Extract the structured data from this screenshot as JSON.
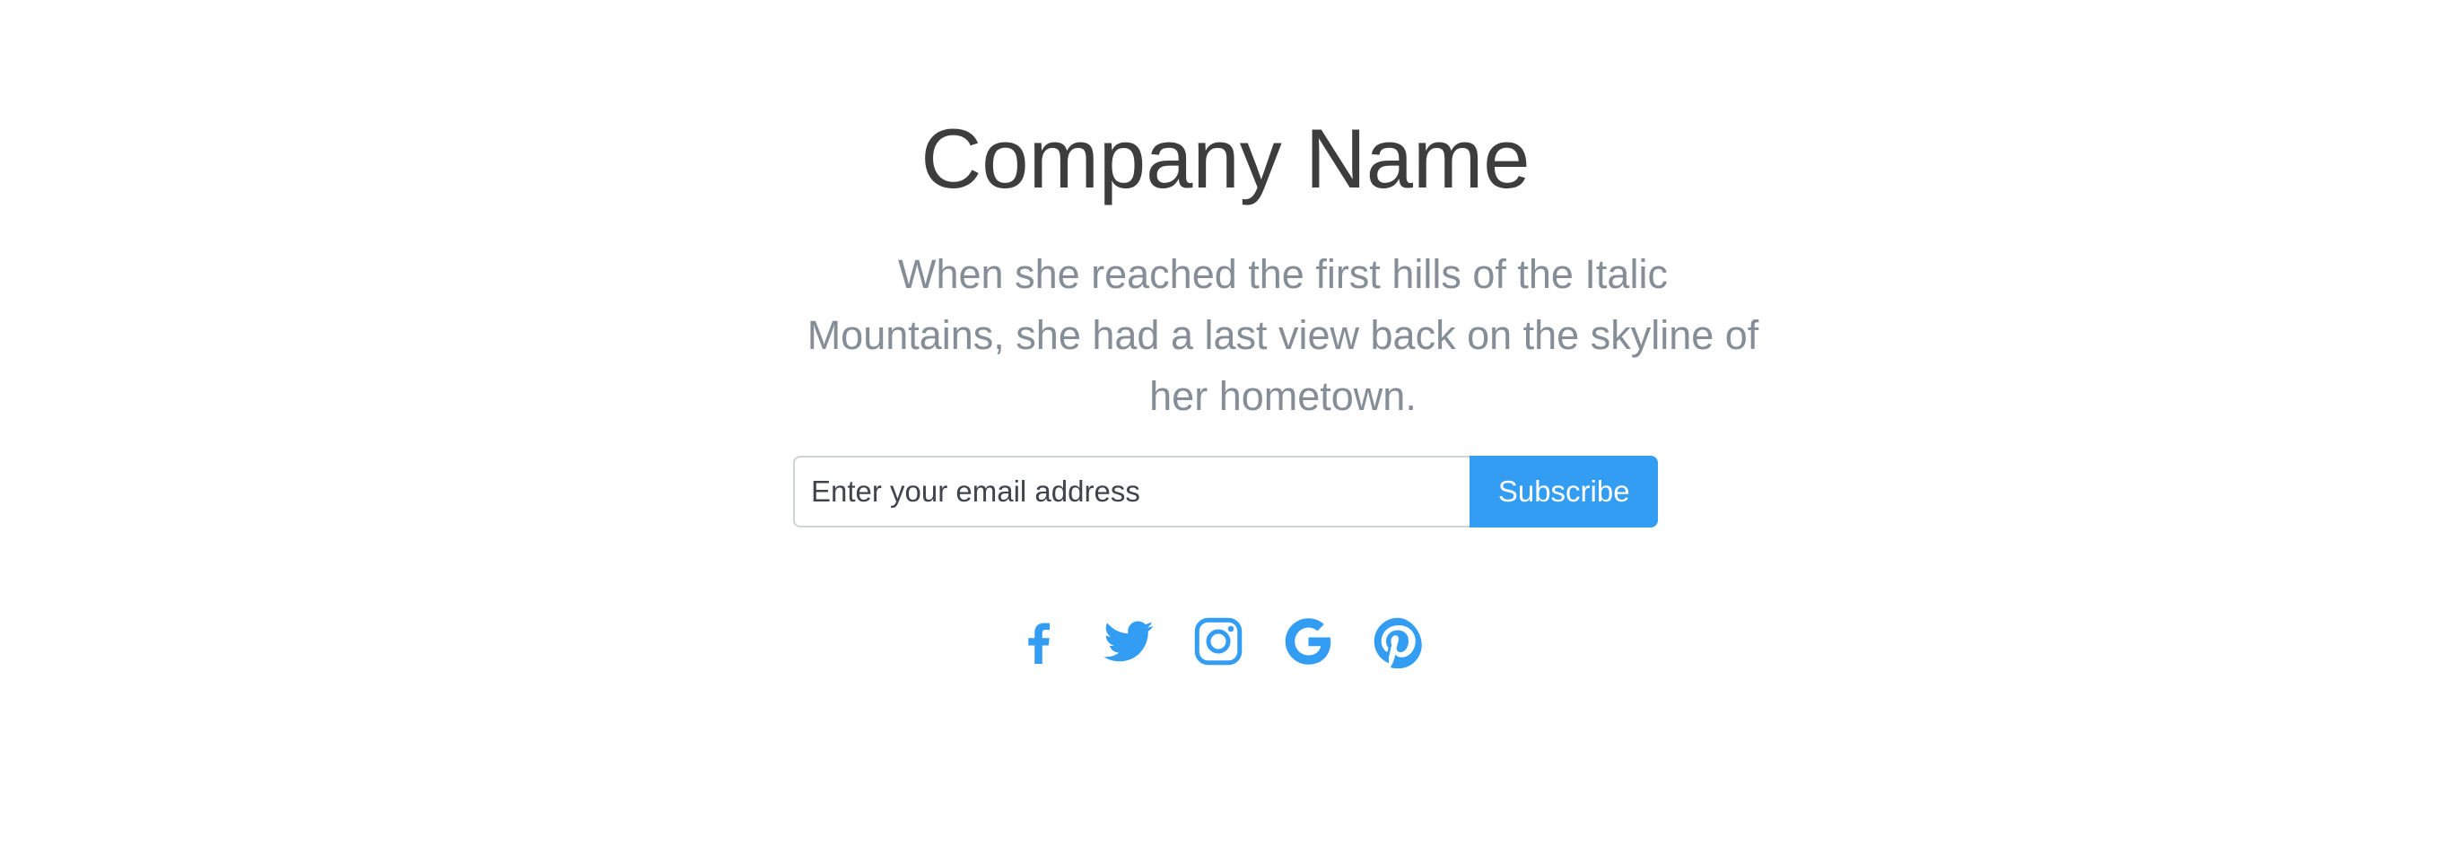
{
  "header": {
    "title": "Company Name",
    "tagline": "When she reached the first hills of the Italic Mountains, she had a last view back on the skyline of her hometown."
  },
  "subscribe": {
    "email_placeholder": "Enter your email address",
    "email_value": "",
    "button_label": "Subscribe"
  },
  "social": [
    {
      "name": "Facebook",
      "icon": "facebook-icon"
    },
    {
      "name": "Twitter",
      "icon": "twitter-icon"
    },
    {
      "name": "Instagram",
      "icon": "instagram-icon"
    },
    {
      "name": "Google",
      "icon": "google-icon"
    },
    {
      "name": "Pinterest",
      "icon": "pinterest-icon"
    }
  ],
  "colors": {
    "accent": "#339cf3",
    "title": "#3d3d3d",
    "tagline": "#858d97",
    "background": "#ffffff"
  }
}
